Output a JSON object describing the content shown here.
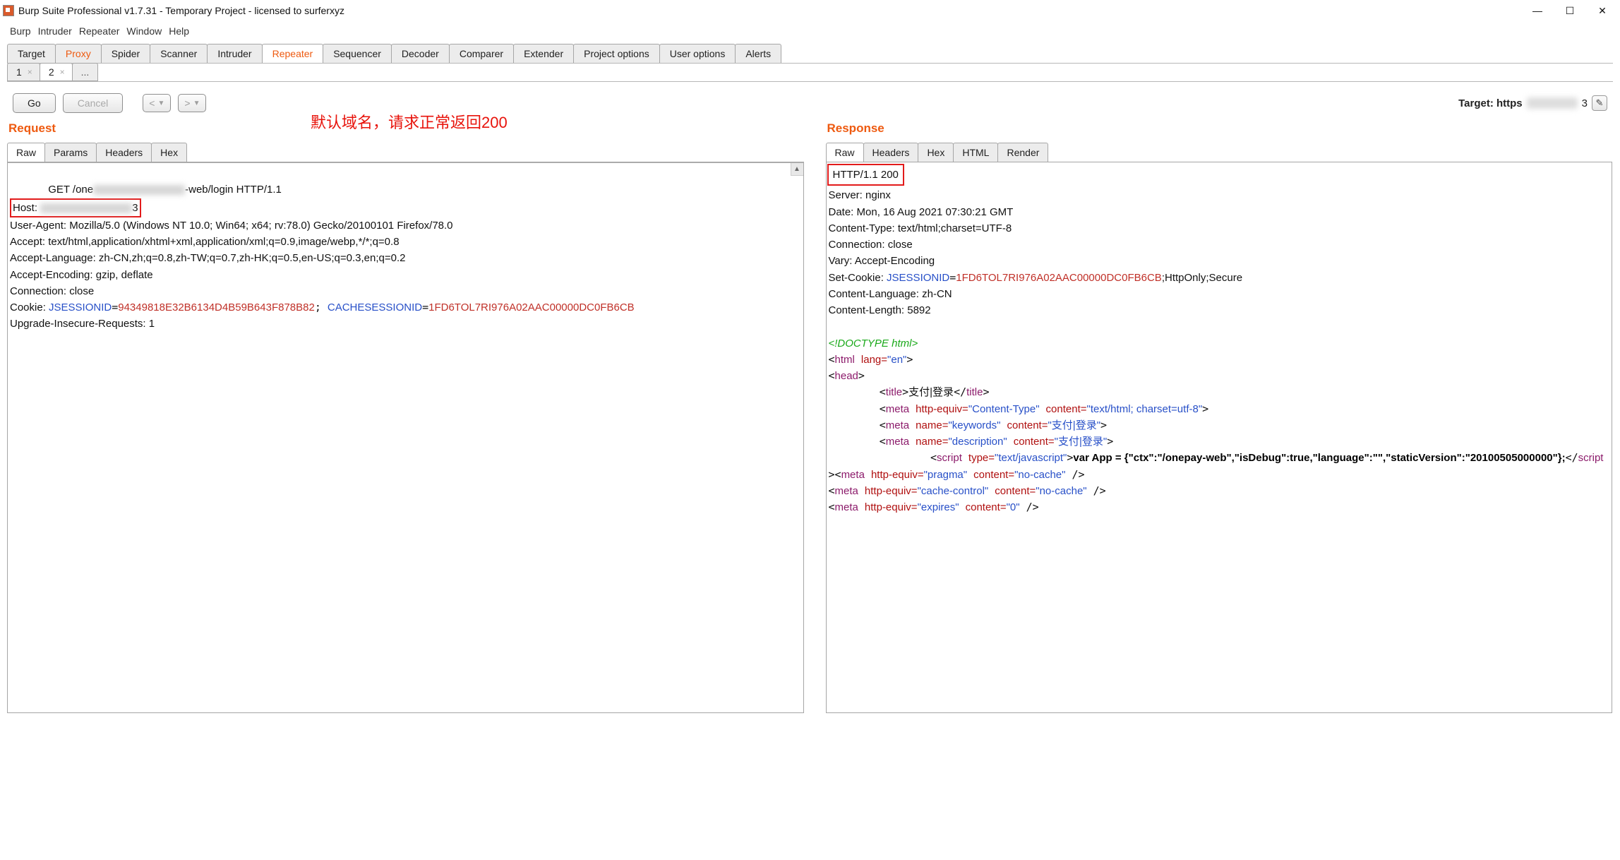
{
  "window": {
    "title": "Burp Suite Professional v1.7.31 - Temporary Project - licensed to surferxyz"
  },
  "menu": [
    "Burp",
    "Intruder",
    "Repeater",
    "Window",
    "Help"
  ],
  "main_tabs": [
    {
      "label": "Target"
    },
    {
      "label": "Proxy",
      "orange": true
    },
    {
      "label": "Spider"
    },
    {
      "label": "Scanner"
    },
    {
      "label": "Intruder"
    },
    {
      "label": "Repeater",
      "active": true,
      "orange": true
    },
    {
      "label": "Sequencer"
    },
    {
      "label": "Decoder"
    },
    {
      "label": "Comparer"
    },
    {
      "label": "Extender"
    },
    {
      "label": "Project options"
    },
    {
      "label": "User options"
    },
    {
      "label": "Alerts"
    }
  ],
  "rep_tabs": [
    {
      "label": "1"
    },
    {
      "label": "2",
      "active": true
    }
  ],
  "toolbar": {
    "go": "Go",
    "cancel": "Cancel",
    "target_label": "Target: https",
    "target_suffix": "3"
  },
  "annotation": "默认域名，请求正常返回200",
  "request": {
    "title": "Request",
    "tabs": [
      "Raw",
      "Params",
      "Headers",
      "Hex"
    ],
    "line1_a": "GET /one",
    "line1_b": "-web/login HTTP/1.1",
    "host_label": "Host: ",
    "host_suffix": "3",
    "ua": "User-Agent: Mozilla/5.0 (Windows NT 10.0; Win64; x64; rv:78.0) Gecko/20100101 Firefox/78.0",
    "accept": "Accept: text/html,application/xhtml+xml,application/xml;q=0.9,image/webp,*/*;q=0.8",
    "al": "Accept-Language: zh-CN,zh;q=0.8,zh-TW;q=0.7,zh-HK;q=0.5,en-US;q=0.3,en;q=0.2",
    "ae": "Accept-Encoding: gzip, deflate",
    "conn": "Connection: close",
    "cookie_prefix": "Cookie: ",
    "jsid_k": "JSESSIONID",
    "jsid_v": "94349818E32B6134D4B59B643F878B82",
    "csid_k": "CACHESESSIONID",
    "csid_v": "1FD6TOL7RI976A02AAC00000DC0FB6CB",
    "uir": "Upgrade-Insecure-Requests: 1"
  },
  "response": {
    "title": "Response",
    "tabs": [
      "Raw",
      "Headers",
      "Hex",
      "HTML",
      "Render"
    ],
    "status": "HTTP/1.1 200",
    "server": "Server: nginx",
    "date": "Date: Mon, 16 Aug 2021 07:30:21 GMT",
    "ct": "Content-Type: text/html;charset=UTF-8",
    "conn": "Connection: close",
    "vary": "Vary: Accept-Encoding",
    "setcookie_prefix": "Set-Cookie: ",
    "setcookie_k": "JSESSIONID",
    "setcookie_v": "1FD6TOL7RI976A02AAC00000DC0FB6CB",
    "setcookie_suffix": ";HttpOnly;Secure",
    "cl": "Content-Language: zh-CN",
    "clen": "Content-Length: 5892",
    "doctype": "<!DOCTYPE html>",
    "html_open_a": "html",
    "html_lang_attr": "lang=",
    "html_lang_val": "\"en\"",
    "head": "head",
    "title_tag": "title",
    "title_text": "支付|登录",
    "meta": "meta",
    "http_equiv": "http-equiv=",
    "name_attr": "name=",
    "content_attr": "content=",
    "type_attr": "type=",
    "ct_val": "\"Content-Type\"",
    "ct_c": "\"text/html; charset=utf-8\"",
    "kw_val": "\"keywords\"",
    "kw_c": "\"支付|登录\"",
    "desc_val": "\"description\"",
    "desc_c": "\"支付|登录\"",
    "script_tag": "script",
    "js_val": "\"text/javascript\"",
    "var_app": "var App = {\"ctx\":\"/onepay-web\",\"isDebug\":true,\"language\":\"\",\"staticVersion\":\"20100505000000\"};",
    "scri": "scri",
    "pt": "pt",
    "pragma_val": "\"pragma\"",
    "nocache": "\"no-cache\"",
    "cc_val": "\"cache-control\"",
    "exp_val": "\"expires\"",
    "zero": "\"0\""
  }
}
